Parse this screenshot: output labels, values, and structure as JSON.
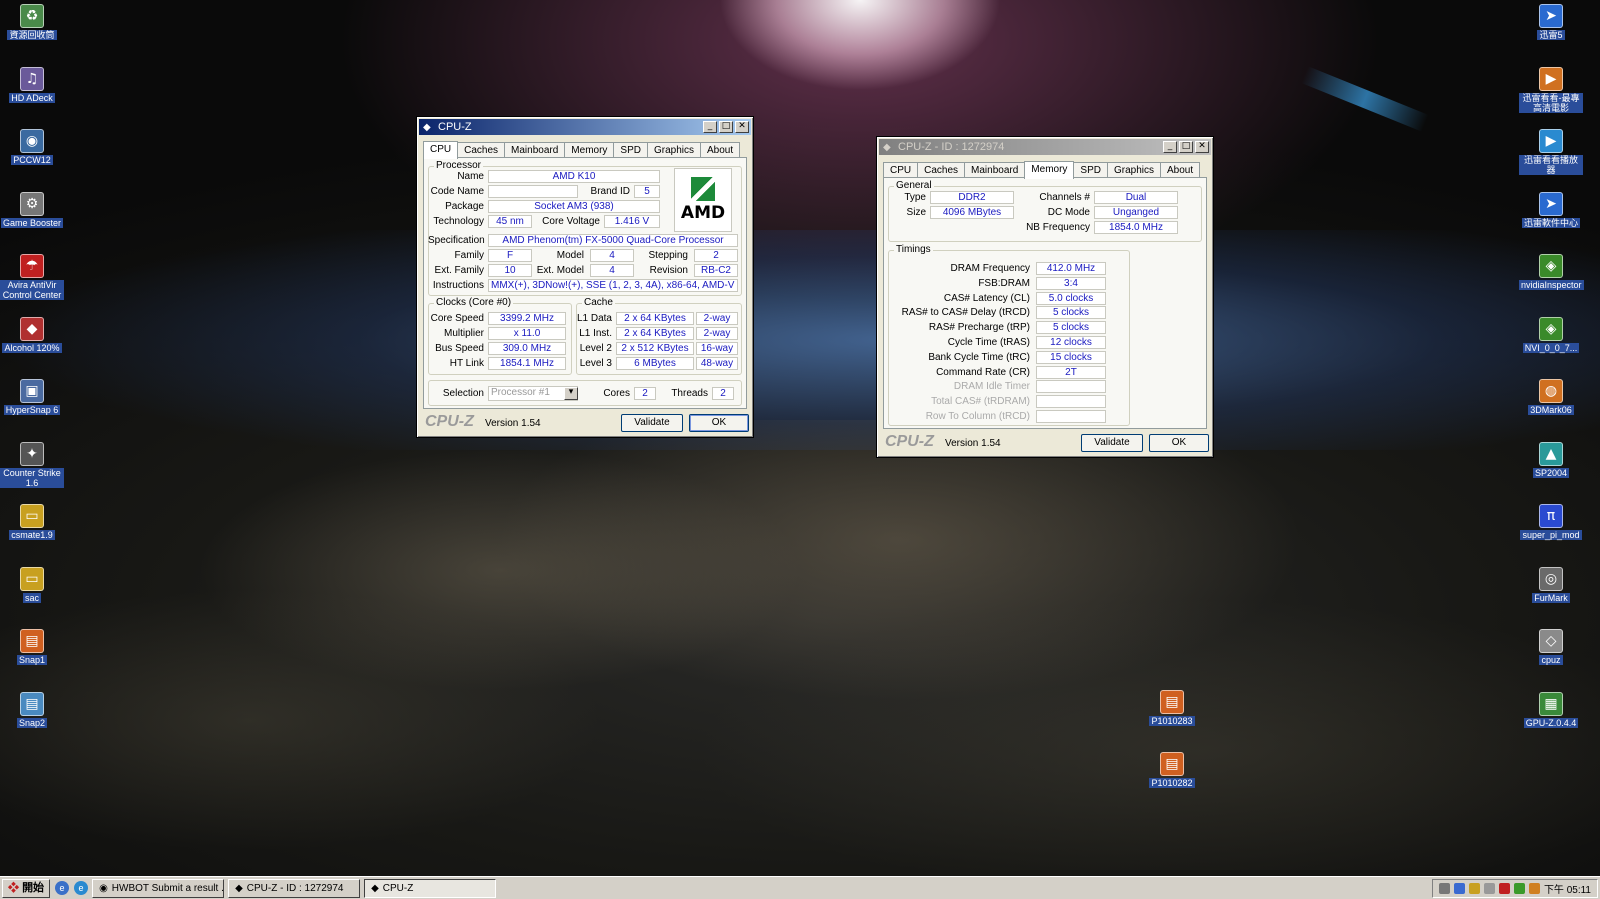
{
  "desktop": {
    "left_icons": [
      {
        "label": "資源回收筒",
        "glyph": "♻",
        "color": "#4a8a4a"
      },
      {
        "label": "HD ADeck",
        "glyph": "♫",
        "color": "#6a5a9a"
      },
      {
        "label": "PCCW12",
        "glyph": "◉",
        "color": "#3a6aa0"
      },
      {
        "label": "Game Booster",
        "glyph": "⚙",
        "color": "#777777"
      },
      {
        "label": "Avira AntiVir Control Center",
        "glyph": "☂",
        "color": "#c02020"
      },
      {
        "label": "Alcohol 120%",
        "glyph": "◆",
        "color": "#b03030"
      },
      {
        "label": "HyperSnap 6",
        "glyph": "▣",
        "color": "#4a6aa0"
      },
      {
        "label": "Counter Strike 1.6",
        "glyph": "✦",
        "color": "#555555"
      },
      {
        "label": "csmate1.9",
        "glyph": "▭",
        "color": "#c8a020"
      },
      {
        "label": "sac",
        "glyph": "▭",
        "color": "#c8a020"
      },
      {
        "label": "Snap1",
        "glyph": "▤",
        "color": "#d06020"
      },
      {
        "label": "Snap2",
        "glyph": "▤",
        "color": "#4a8ac0"
      }
    ],
    "right_icons": [
      {
        "label": "迅雷5",
        "glyph": "➤",
        "color": "#2a6ad0"
      },
      {
        "label": "迅雷看看-最專高清電影",
        "glyph": "▶",
        "color": "#d07020"
      },
      {
        "label": "迅雷看看播放器",
        "glyph": "▶",
        "color": "#2a8ad0"
      },
      {
        "label": "迅雷軟件中心",
        "glyph": "➤",
        "color": "#2a6ad0"
      },
      {
        "label": "nvidiaInspector",
        "glyph": "◈",
        "color": "#3a8a2a"
      },
      {
        "label": "NVI_0_0_7...",
        "glyph": "◈",
        "color": "#3a8a2a"
      },
      {
        "label": "3DMark06",
        "glyph": "◍",
        "color": "#d07020"
      },
      {
        "label": "SP2004",
        "glyph": "▲",
        "color": "#2a9a9a"
      },
      {
        "label": "super_pi_mod",
        "glyph": "π",
        "color": "#2a4ad0"
      },
      {
        "label": "FurMark",
        "glyph": "◎",
        "color": "#6a6a6a"
      },
      {
        "label": "cpuz",
        "glyph": "◇",
        "color": "#8a8a8a"
      },
      {
        "label": "GPU-Z.0.4.4",
        "glyph": "▦",
        "color": "#3a8a3a"
      }
    ],
    "files": [
      {
        "label": "P1010283",
        "glyph": "▤",
        "color": "#d06020"
      },
      {
        "label": "P1010282",
        "glyph": "▤",
        "color": "#d06020"
      }
    ]
  },
  "cpu_window": {
    "title": "CPU-Z",
    "tabs": [
      "CPU",
      "Caches",
      "Mainboard",
      "Memory",
      "SPD",
      "Graphics",
      "About"
    ],
    "processor_group": "Processor",
    "name_label": "Name",
    "name": "AMD K10",
    "codename_label": "Code Name",
    "codename": "",
    "brandid_label": "Brand ID",
    "brandid": "5",
    "package_label": "Package",
    "package": "Socket AM3 (938)",
    "technology_label": "Technology",
    "technology": "45 nm",
    "corevoltage_label": "Core Voltage",
    "corevoltage": "1.416 V",
    "spec_label": "Specification",
    "spec": "AMD Phenom(tm) FX-5000 Quad-Core Processor",
    "family_label": "Family",
    "family": "F",
    "model_label": "Model",
    "model": "4",
    "stepping_label": "Stepping",
    "stepping": "2",
    "extfamily_label": "Ext. Family",
    "extfamily": "10",
    "extmodel_label": "Ext. Model",
    "extmodel": "4",
    "revision_label": "Revision",
    "revision": "RB-C2",
    "instructions_label": "Instructions",
    "instructions": "MMX(+), 3DNow!(+), SSE (1, 2, 3, 4A), x86-64, AMD-V",
    "logo_text": "AMD",
    "clocks_group": "Clocks (Core #0)",
    "corespeed_label": "Core Speed",
    "corespeed": "3399.2 MHz",
    "multiplier_label": "Multiplier",
    "multiplier": "x 11.0",
    "busspeed_label": "Bus Speed",
    "busspeed": "309.0 MHz",
    "htlink_label": "HT Link",
    "htlink": "1854.1 MHz",
    "cache_group": "Cache",
    "l1data_label": "L1 Data",
    "l1data": "2 x 64 KBytes",
    "l1data_way": "2-way",
    "l1inst_label": "L1 Inst.",
    "l1inst": "2 x 64 KBytes",
    "l1inst_way": "2-way",
    "l2_label": "Level 2",
    "l2": "2 x 512 KBytes",
    "l2_way": "16-way",
    "l3_label": "Level 3",
    "l3": "6 MBytes",
    "l3_way": "48-way",
    "selection_label": "Selection",
    "selection": "Processor #1",
    "cores_label": "Cores",
    "cores": "2",
    "threads_label": "Threads",
    "threads": "2",
    "brand": "CPU-Z",
    "version": "Version 1.54",
    "validate": "Validate",
    "ok": "OK"
  },
  "mem_window": {
    "title": "CPU-Z - ID : 1272974",
    "tabs": [
      "CPU",
      "Caches",
      "Mainboard",
      "Memory",
      "SPD",
      "Graphics",
      "About"
    ],
    "general_group": "General",
    "type_label": "Type",
    "type": "DDR2",
    "size_label": "Size",
    "size": "4096 MBytes",
    "channels_label": "Channels #",
    "channels": "Dual",
    "dcmode_label": "DC Mode",
    "dcmode": "Unganged",
    "nbfreq_label": "NB Frequency",
    "nbfreq": "1854.0 MHz",
    "timings_group": "Timings",
    "timings": [
      {
        "label": "DRAM Frequency",
        "value": "412.0 MHz",
        "dim": false
      },
      {
        "label": "FSB:DRAM",
        "value": "3:4",
        "dim": false
      },
      {
        "label": "CAS# Latency (CL)",
        "value": "5.0 clocks",
        "dim": false
      },
      {
        "label": "RAS# to CAS# Delay (tRCD)",
        "value": "5 clocks",
        "dim": false
      },
      {
        "label": "RAS# Precharge (tRP)",
        "value": "5 clocks",
        "dim": false
      },
      {
        "label": "Cycle Time (tRAS)",
        "value": "12 clocks",
        "dim": false
      },
      {
        "label": "Bank Cycle Time (tRC)",
        "value": "15 clocks",
        "dim": false
      },
      {
        "label": "Command Rate (CR)",
        "value": "2T",
        "dim": false
      },
      {
        "label": "DRAM Idle Timer",
        "value": "",
        "dim": true
      },
      {
        "label": "Total CAS# (tRDRAM)",
        "value": "",
        "dim": true
      },
      {
        "label": "Row To Column (tRCD)",
        "value": "",
        "dim": true
      }
    ],
    "brand": "CPU-Z",
    "version": "Version 1.54",
    "validate": "Validate",
    "ok": "OK"
  },
  "taskbar": {
    "start": "開始",
    "tasks": [
      {
        "label": "HWBOT Submit a result ...",
        "pressed": false
      },
      {
        "label": "CPU-Z - ID : 1272974",
        "pressed": false
      },
      {
        "label": "CPU-Z",
        "pressed": true
      }
    ],
    "clock": "下午 05:11"
  }
}
